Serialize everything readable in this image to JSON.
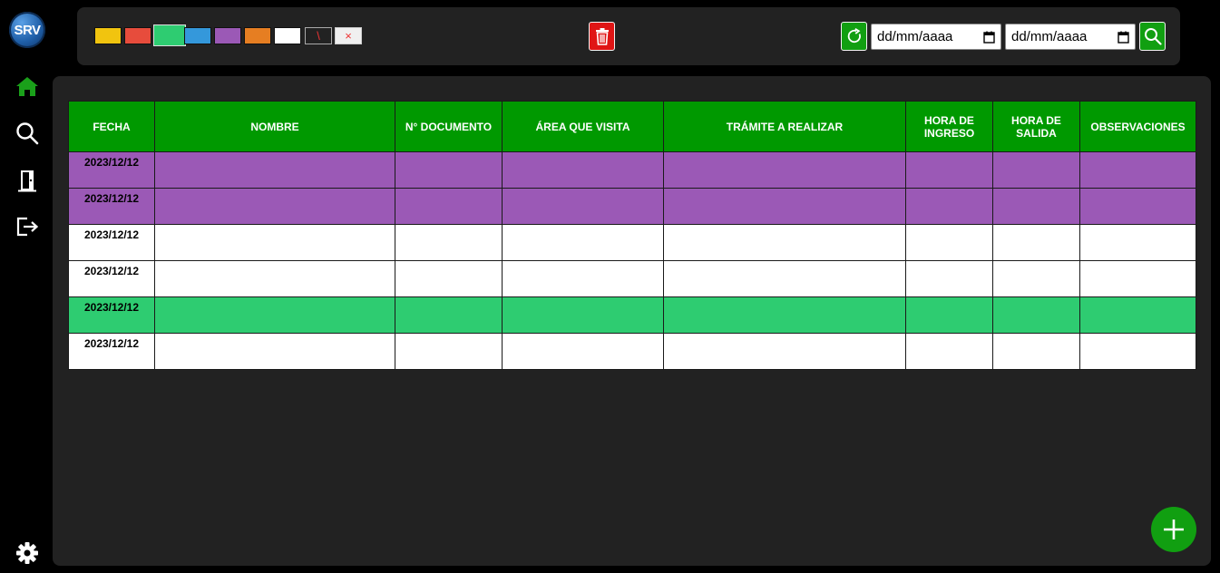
{
  "app": {
    "logo_text": "SRV"
  },
  "sidebar": {
    "items": [
      {
        "name": "home-icon",
        "color": "#1aa01a"
      },
      {
        "name": "search-icon",
        "color": "#ffffff"
      },
      {
        "name": "door-icon",
        "color": "#ffffff"
      },
      {
        "name": "logout-icon",
        "color": "#ffffff"
      },
      {
        "name": "gear-icon",
        "color": "#ffffff"
      }
    ]
  },
  "toolbar": {
    "swatches": [
      {
        "name": "yellow",
        "color": "#f1c40f"
      },
      {
        "name": "red",
        "color": "#e74c3c"
      },
      {
        "name": "green",
        "color": "#2ecc71",
        "selected": true
      },
      {
        "name": "blue",
        "color": "#3498db"
      },
      {
        "name": "purple",
        "color": "#9b59b6"
      },
      {
        "name": "orange",
        "color": "#e67e22"
      },
      {
        "name": "white",
        "color": "#ffffff"
      },
      {
        "name": "strike",
        "color": "#222222",
        "glyph": "\\"
      },
      {
        "name": "clear",
        "color": "#f0f0f0",
        "glyph": "×"
      }
    ],
    "date_from": {
      "placeholder": "dd/mm/aaaa"
    },
    "date_to": {
      "placeholder": "dd/mm/aaaa"
    }
  },
  "table": {
    "columns": [
      "FECHA",
      "NOMBRE",
      "N° DOCUMENTO",
      "ÁREA QUE VISITA",
      "TRÁMITE A REALIZAR",
      "HORA DE INGRESO",
      "HORA DE SALIDA",
      "OBSERVACIONES"
    ],
    "rows": [
      {
        "color": "purple",
        "cells": [
          "2023/12/12",
          "",
          "",
          "",
          "",
          "",
          "",
          ""
        ]
      },
      {
        "color": "purple",
        "cells": [
          "2023/12/12",
          "",
          "",
          "",
          "",
          "",
          "",
          ""
        ]
      },
      {
        "color": "white",
        "cells": [
          "2023/12/12",
          "",
          "",
          "",
          "",
          "",
          "",
          ""
        ]
      },
      {
        "color": "white",
        "cells": [
          "2023/12/12",
          "",
          "",
          "",
          "",
          "",
          "",
          ""
        ]
      },
      {
        "color": "green",
        "cells": [
          "2023/12/12",
          "",
          "",
          "",
          "",
          "",
          "",
          ""
        ]
      },
      {
        "color": "white",
        "cells": [
          "2023/12/12",
          "",
          "",
          "",
          "",
          "",
          "",
          ""
        ]
      }
    ]
  },
  "colors": {
    "accent_green": "#119f11",
    "header_green": "#009900",
    "danger_red": "#e01515"
  }
}
